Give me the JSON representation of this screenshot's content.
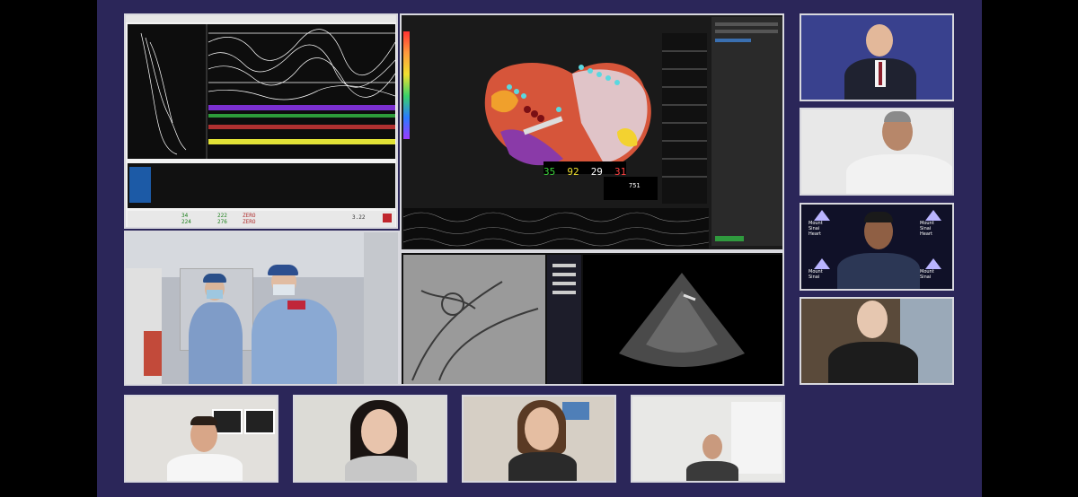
{
  "ep_software": {
    "vitals": [
      "35",
      "92",
      "29",
      "31"
    ],
    "readout_value": "751",
    "panel_title": "751"
  },
  "mapping_panel": {
    "buttons": [
      "ZERO",
      "ZERO"
    ],
    "values": [
      "34",
      "224",
      "222",
      "276",
      "3.22"
    ]
  },
  "logos": {
    "lines": [
      "Mount",
      "Sinai",
      "Heart"
    ]
  },
  "colors": {
    "stage_bg": "#2b2659",
    "tile_border": "#d8d8de"
  },
  "participants": [
    {
      "name": "participant-1"
    },
    {
      "name": "participant-2"
    },
    {
      "name": "participant-3"
    },
    {
      "name": "participant-4"
    },
    {
      "name": "participant-5"
    },
    {
      "name": "participant-6"
    },
    {
      "name": "participant-7"
    },
    {
      "name": "participant-8"
    }
  ]
}
